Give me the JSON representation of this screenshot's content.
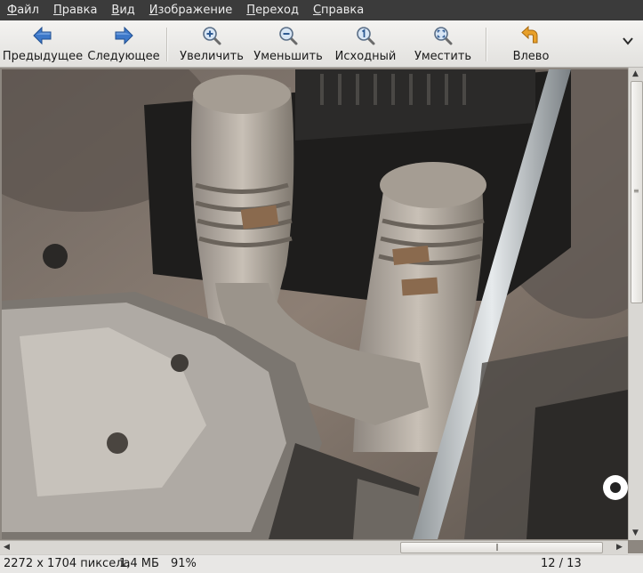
{
  "menu": {
    "items": [
      {
        "first": "Ф",
        "rest": "айл"
      },
      {
        "first": "П",
        "rest": "равка"
      },
      {
        "first": "В",
        "rest": "ид"
      },
      {
        "first": "И",
        "rest": "зображение"
      },
      {
        "first": "П",
        "rest": "ереход"
      },
      {
        "first": "С",
        "rest": "правка"
      }
    ]
  },
  "toolbar": {
    "prev_label": "Предыдущее",
    "next_label": "Следующее",
    "zoom_in_label": "Увеличить",
    "zoom_out_label": "Уменьшить",
    "original_label": "Исходный",
    "fit_label": "Уместить",
    "rotate_left_label": "Влево"
  },
  "icons": {
    "prev": "arrow-left-icon",
    "next": "arrow-right-icon",
    "zoom_in": "magnifier-plus-icon",
    "zoom_out": "magnifier-minus-icon",
    "original": "magnifier-one-icon",
    "fit": "magnifier-fit-icon",
    "rotate_left": "rotate-left-icon",
    "overflow": "chevron-down-icon"
  },
  "colors": {
    "menubar": "#3b3b3b",
    "arrow_blue": "#3d78c9",
    "rotate_orange": "#e8a02a"
  },
  "status": {
    "dimensions": "2272 x 1704 пиксела",
    "size": "1,4 МБ",
    "zoom": "91%",
    "position": "12 / 13"
  }
}
